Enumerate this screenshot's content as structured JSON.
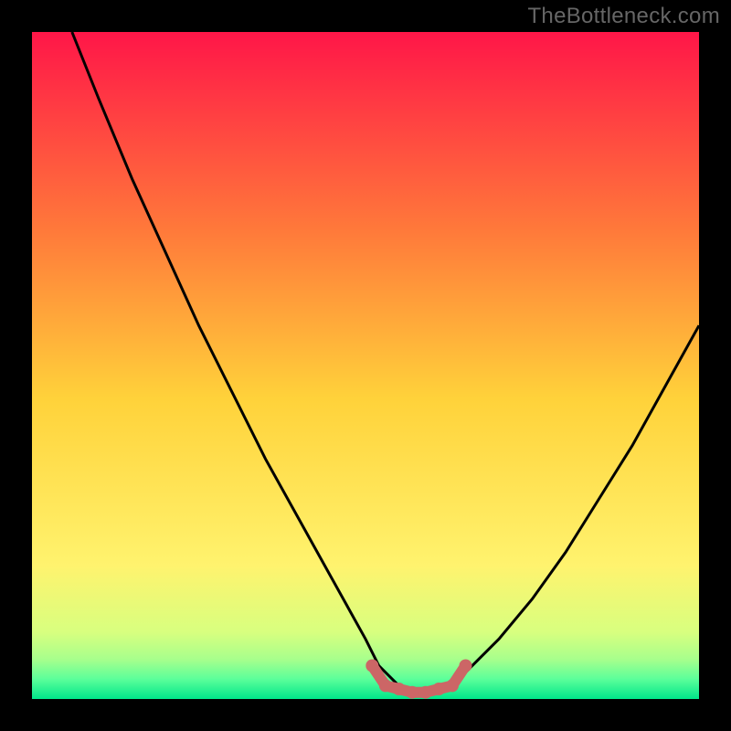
{
  "watermark": "TheBottleneck.com",
  "colors": {
    "frame": "#000000",
    "curve": "#000000",
    "marker": "#cc6666",
    "gradient_top": "#ff1648",
    "gradient_upper": "#ff7a3a",
    "gradient_mid": "#ffd23a",
    "gradient_lower": "#fff36e",
    "gradient_band1": "#d8ff7f",
    "gradient_band2": "#a8ff8c",
    "gradient_band3": "#5cff9a",
    "gradient_bottom": "#00e68a"
  },
  "chart_data": {
    "type": "line",
    "title": "",
    "xlabel": "",
    "ylabel": "",
    "xlim": [
      0,
      100
    ],
    "ylim": [
      0,
      100
    ],
    "series": [
      {
        "name": "bottleneck-curve",
        "x": [
          6,
          10,
          15,
          20,
          25,
          30,
          35,
          40,
          45,
          50,
          52,
          55,
          58,
          60,
          62,
          65,
          70,
          75,
          80,
          85,
          90,
          95,
          100
        ],
        "values": [
          100,
          90,
          78,
          67,
          56,
          46,
          36,
          27,
          18,
          9,
          5,
          2,
          1,
          1,
          2,
          4,
          9,
          15,
          22,
          30,
          38,
          47,
          56
        ]
      }
    ],
    "optimal_region": {
      "name": "optimal-band",
      "x": [
        51,
        53,
        55,
        57,
        59,
        61,
        63,
        65
      ],
      "values": [
        5,
        2,
        1.5,
        1,
        1,
        1.5,
        2,
        5
      ]
    }
  }
}
